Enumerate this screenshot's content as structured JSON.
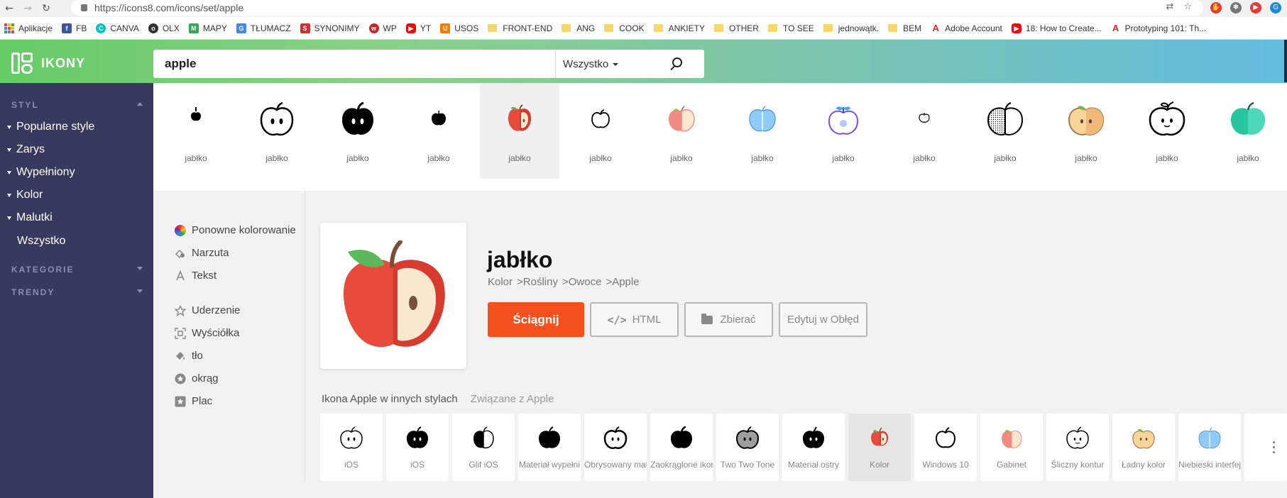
{
  "browser": {
    "url": "https://icons8.com/icons/set/apple",
    "bookmarks": [
      "Aplikacje",
      "FB",
      "CANVA",
      "OLX",
      "MAPY",
      "TŁUMACZ",
      "SYNONIMY",
      "WP",
      "YT",
      "USOS",
      "FRONT-END",
      "ANG",
      "COOK",
      "ANKIETY",
      "OTHER",
      "TO SEE",
      "jednowątk.",
      "BEM",
      "Adobe Account",
      "18: How to Create...",
      "Prototyping 101: Th..."
    ]
  },
  "header": {
    "logo": "IKONY",
    "search_value": "apple",
    "filter": "Wszystko"
  },
  "sidebar": {
    "style_heading": "STYL",
    "items": [
      "Popularne style",
      "Zarys",
      "Wypełniony",
      "Kolor",
      "Malutki"
    ],
    "all": "Wszystko",
    "categories": "KATEGORIE",
    "trends": "TRENDY"
  },
  "strip": {
    "label": "jabłko",
    "icons": [
      "ios-outline",
      "ios",
      "filled",
      "small",
      "color",
      "win10",
      "office",
      "blue-ui",
      "dusk",
      "tiny",
      "dotted",
      "cute-color",
      "doodle",
      "fluency"
    ]
  },
  "tools": {
    "items": [
      "Ponowne kolorowanie",
      "Narzuta",
      "Tekst",
      "Uderzenie",
      "Wyściółka",
      "tło",
      "okrąg",
      "Plac"
    ]
  },
  "detail": {
    "title": "jabłko",
    "breadcrumbs": [
      "Kolor",
      ">Rośliny",
      ">Owoce",
      ">Apple"
    ],
    "download": "Ściągnij",
    "html": "HTML",
    "collect": "Zbierać",
    "edit": "Edytuj w Obłęd"
  },
  "tabs": {
    "styles": "Ikona Apple w innych stylach",
    "related": "Związane z Apple"
  },
  "styles": [
    "iOS",
    "iOS",
    "Glif iOS",
    "Materiał wypełni",
    "Obrysowany mat",
    "Zaokrąglone ikor",
    "Two Two Tone",
    "Materiał ostry",
    "Kolor",
    "Windows 10",
    "Gabinet",
    "Śliczny kontur",
    "Ładny kolor",
    "Niebieski interfej"
  ],
  "colors": {
    "accent": "#f4511e",
    "sidebar": "#373a5e",
    "apple_red": "#e84a3c",
    "apple_light": "#fbe7d0",
    "leaf": "#5cb85c"
  }
}
